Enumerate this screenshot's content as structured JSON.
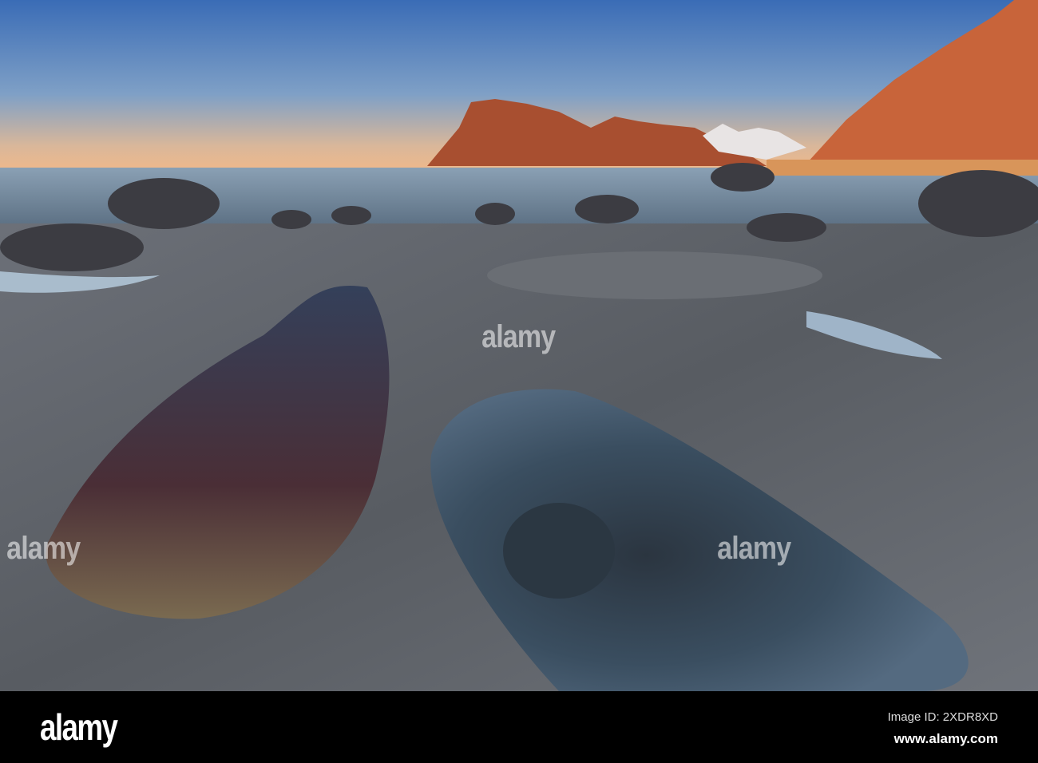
{
  "watermark": {
    "logo": "alamy",
    "image_id": "Image ID: 2XDR8XD",
    "url": "www.alamy.com"
  },
  "colors": {
    "sky_top": "#3f6fb5",
    "sky_horizon": "#e9b98a",
    "mountain_lit": "#c8653a",
    "rock": "#5c6066",
    "pool": "#2a3444"
  }
}
